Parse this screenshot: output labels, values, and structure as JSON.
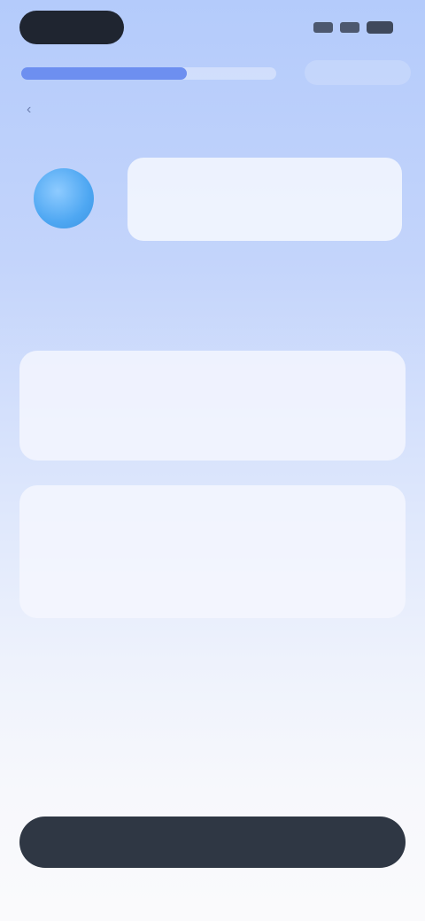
{
  "status_bar": {
    "time": "",
    "signal_icon": "signal-icon",
    "battery_icon": "battery-icon"
  },
  "header": {
    "progress": 0.65,
    "close_label": "",
    "back_icon": "chevron-left-icon"
  },
  "chat": {
    "avatar_icon": "assistant-avatar",
    "message": ""
  },
  "options": [
    {
      "title": "",
      "subtitle": ""
    },
    {
      "title": "",
      "subtitle": ""
    }
  ],
  "footer": {
    "continue_label": ""
  },
  "colors": {
    "accent": "#3d5fe0",
    "button_dark": "#2f3744",
    "avatar": "#4ea7f2"
  }
}
